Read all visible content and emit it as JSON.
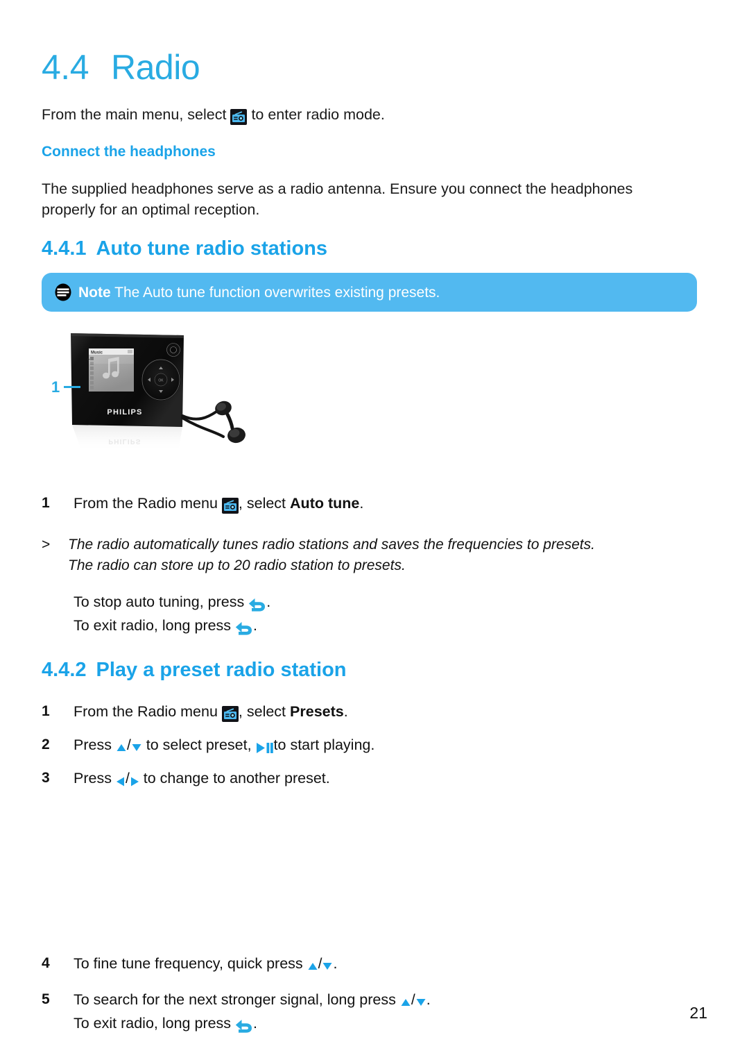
{
  "document": {
    "page_number": "21",
    "accent_blue": "#29abe2",
    "note_box_blue": "#52b9f0",
    "body_text_color": "#111111"
  },
  "section": {
    "number": "4.4",
    "title": "Radio",
    "intro_before": "From the main menu, select",
    "intro_icon": "radio-icon",
    "intro_after": "to enter radio mode.",
    "subheading": "Connect the headphones",
    "headphone_paragraph": "The supplied headphones serve as a radio antenna. Ensure you connect the headphones properly for an optimal reception."
  },
  "subsection_1": {
    "number": "4.4.1",
    "title": "Auto tune radio stations",
    "note": {
      "icon": "note-icon",
      "label": "Note",
      "text": "The Auto tune function overwrites existing presets."
    },
    "figure": {
      "callout_number": "1",
      "device_brand": "PHILIPS",
      "device_screen_title": "Music"
    },
    "steps": [
      {
        "number": "1",
        "text_before": "From the Radio menu",
        "icon": "radio-icon",
        "text_middle": ", select",
        "bold_term": "Auto tune",
        "text_after": "."
      }
    ],
    "result": {
      "marker": ">",
      "line1": "The radio automatically tunes radio stations and saves the frequencies to presets.",
      "line2": "The radio can store up to 20 radio station to presets."
    },
    "extra_lines": [
      {
        "before": "To stop auto tuning, press",
        "icon": "back-arrow-icon",
        "after": "."
      },
      {
        "before": "To exit radio, long press",
        "icon": "back-arrow-icon",
        "after": "."
      }
    ]
  },
  "subsection_2": {
    "number": "4.4.2",
    "title": "Play a preset radio station",
    "steps": [
      {
        "number": "1",
        "text_before": "From the Radio menu",
        "icon": "radio-icon",
        "text_middle": ", select",
        "bold_term": "Presets",
        "text_after": "."
      },
      {
        "number": "2",
        "text_before": "Press",
        "icon_up": "triangle-up-icon",
        "separator": "/",
        "icon_down": "triangle-down-icon",
        "text_middle": "to select preset,",
        "icon_play": "play-pause-icon",
        "text_after": "to start playing."
      },
      {
        "number": "3",
        "text_before": "Press",
        "icon_left": "triangle-left-icon",
        "separator": "/",
        "icon_right": "triangle-right-icon",
        "text_after": "to change to another preset."
      },
      {
        "number": "4",
        "text_before": "To fine tune frequency, quick press",
        "icon_up": "triangle-up-icon",
        "separator": "/",
        "icon_down": "triangle-down-icon",
        "text_after": "."
      },
      {
        "number": "5",
        "text_before": "To search for the next stronger signal, long press",
        "icon_up": "triangle-up-icon",
        "separator": "/",
        "icon_down": "triangle-down-icon",
        "text_after": ".",
        "sub_before": "To exit radio, long press",
        "sub_icon": "back-arrow-icon",
        "sub_after": "."
      }
    ]
  }
}
